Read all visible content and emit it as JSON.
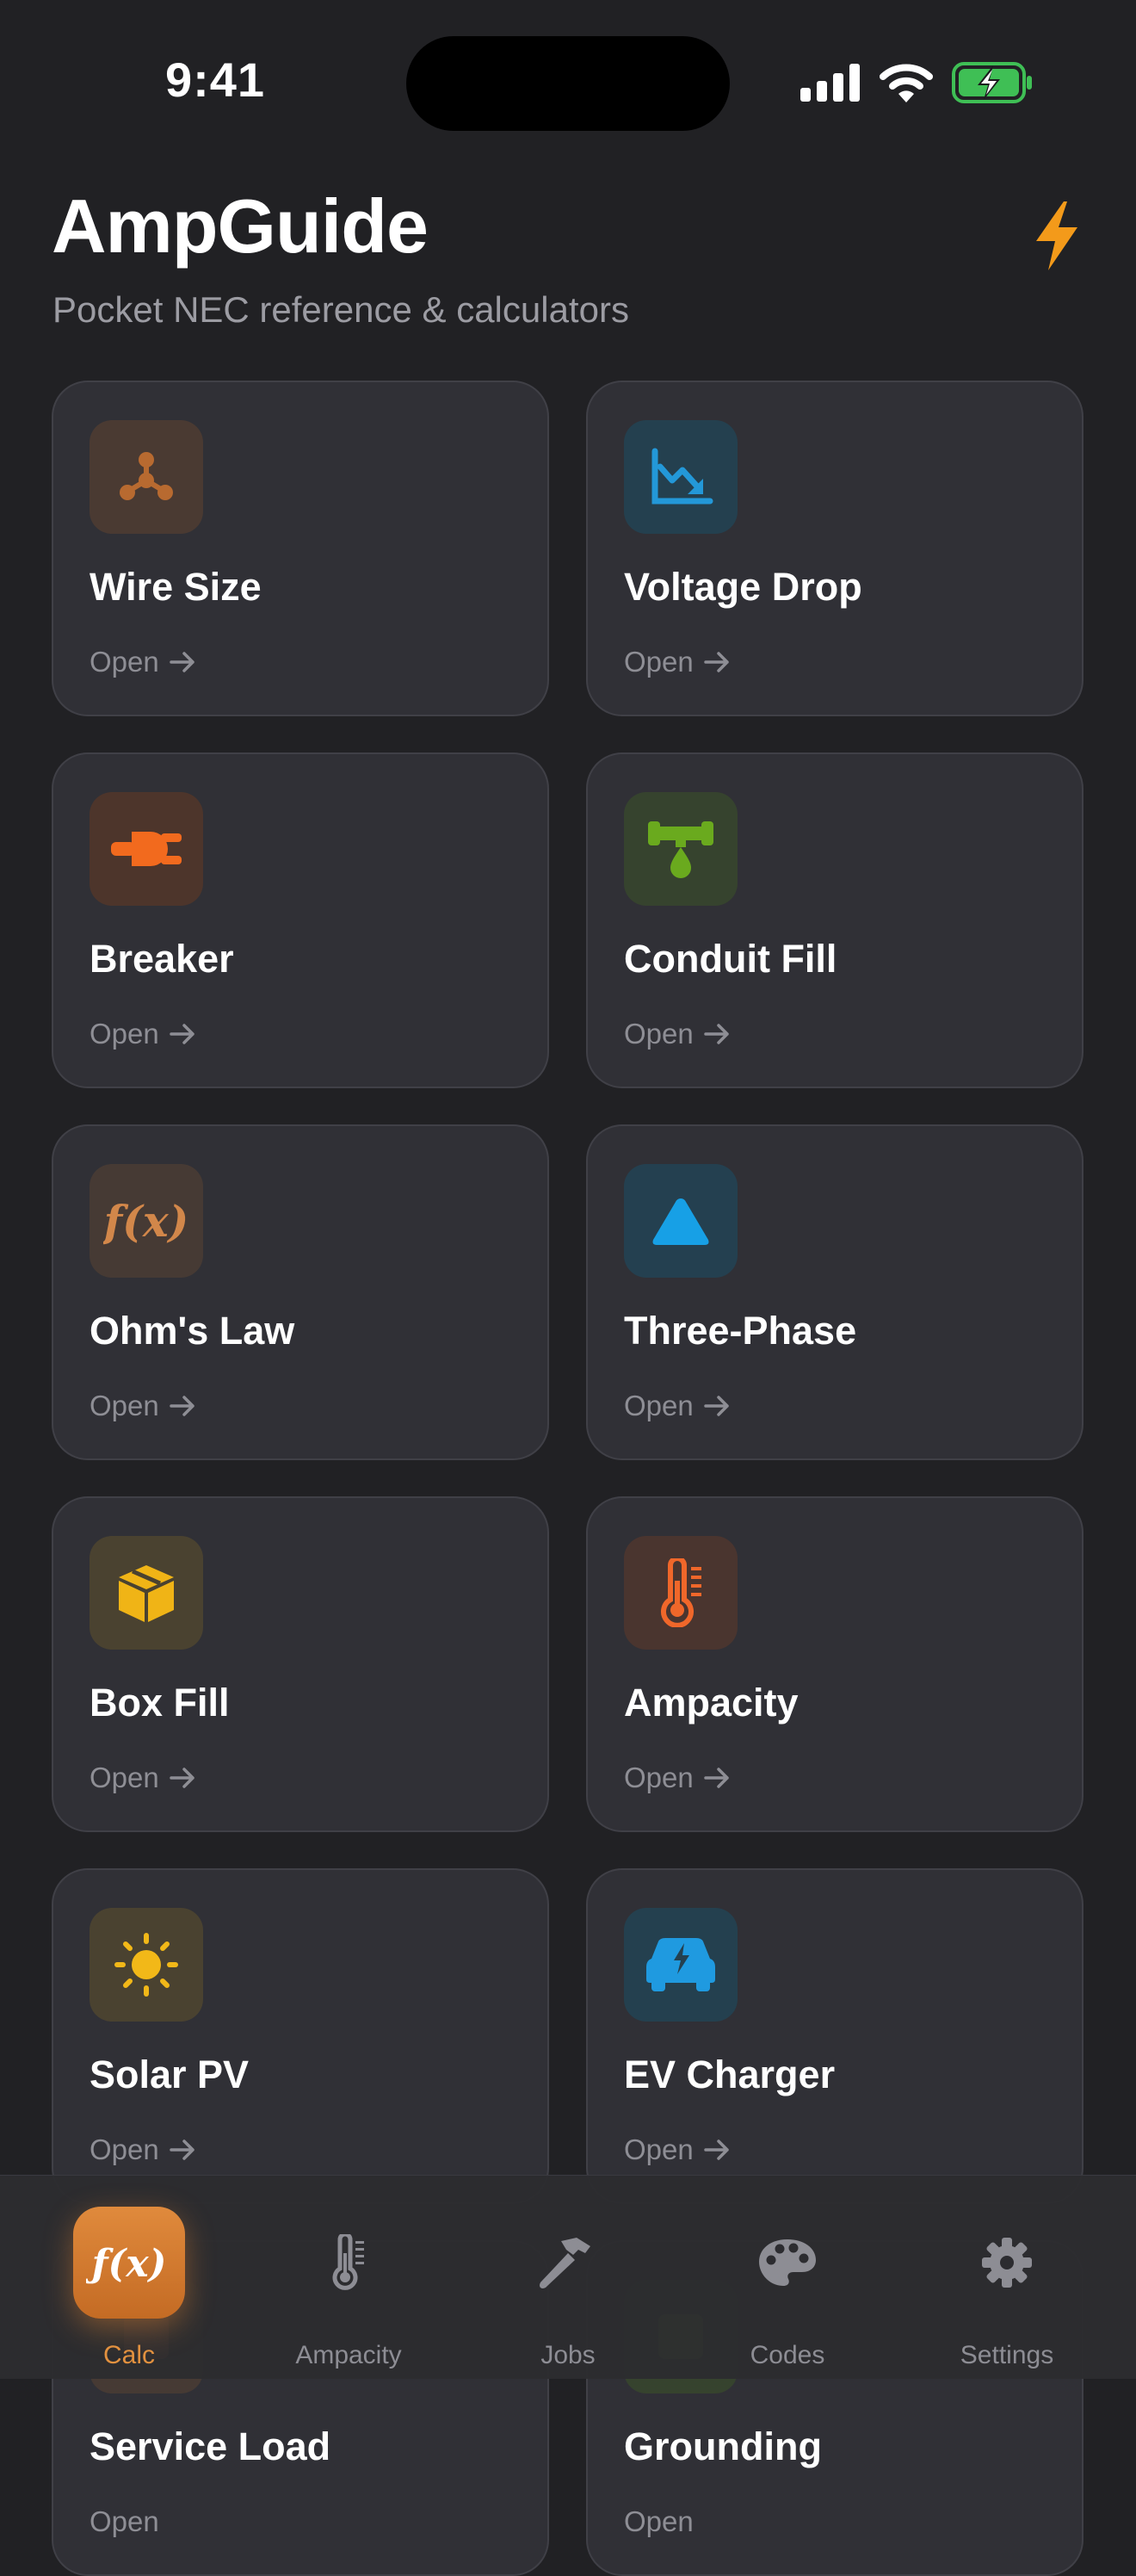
{
  "status_bar": {
    "time": "9:41"
  },
  "header": {
    "title": "AmpGuide",
    "subtitle": "Pocket NEC reference & calculators",
    "action_icon": "bolt-icon"
  },
  "accent_color": "#e2913f",
  "tools": [
    {
      "title": "Wire Size",
      "open_label": "Open",
      "icon": "wire-node-icon",
      "icon_color": "#b86a30",
      "tile_color": "#4a3a32"
    },
    {
      "title": "Voltage Drop",
      "open_label": "Open",
      "icon": "chart-down-icon",
      "icon_color": "#2398d8",
      "tile_color": "#24404f"
    },
    {
      "title": "Breaker",
      "open_label": "Open",
      "icon": "plug-icon",
      "icon_color": "#f26a1e",
      "tile_color": "#4d352b"
    },
    {
      "title": "Conduit Fill",
      "open_label": "Open",
      "icon": "pipe-drop-icon",
      "icon_color": "#6aaa1e",
      "tile_color": "#36432e"
    },
    {
      "title": "Ohm's Law",
      "open_label": "Open",
      "icon": "function-icon",
      "icon_color": "#d2874a",
      "tile_color": "#463a34"
    },
    {
      "title": "Three-Phase",
      "open_label": "Open",
      "icon": "triangle-icon",
      "icon_color": "#17a0e6",
      "tile_color": "#244050"
    },
    {
      "title": "Box Fill",
      "open_label": "Open",
      "icon": "box-icon",
      "icon_color": "#f0b416",
      "tile_color": "#4a4230"
    },
    {
      "title": "Ampacity",
      "open_label": "Open",
      "icon": "thermometer-icon",
      "icon_color": "#f0672a",
      "tile_color": "#4a352f"
    },
    {
      "title": "Solar PV",
      "open_label": "Open",
      "icon": "sun-icon",
      "icon_color": "#f2b818",
      "tile_color": "#4a4230"
    },
    {
      "title": "EV Charger",
      "open_label": "Open",
      "icon": "car-bolt-icon",
      "icon_color": "#1f9ae0",
      "tile_color": "#24404f"
    },
    {
      "title": "Service Load",
      "open_label": "Open",
      "icon": "service-icon",
      "icon_color": "#d2874a",
      "tile_color": "#463a34"
    },
    {
      "title": "Grounding",
      "open_label": "Open",
      "icon": "ground-icon",
      "icon_color": "#6aaa1e",
      "tile_color": "#36432e"
    }
  ],
  "tab_bar": {
    "tabs": [
      {
        "label": "Calc",
        "icon": "function-icon",
        "active": true
      },
      {
        "label": "Ampacity",
        "icon": "thermometer-icon",
        "active": false
      },
      {
        "label": "Jobs",
        "icon": "hammer-icon",
        "active": false
      },
      {
        "label": "Codes",
        "icon": "palette-icon",
        "active": false
      },
      {
        "label": "Settings",
        "icon": "gear-icon",
        "active": false
      }
    ]
  }
}
